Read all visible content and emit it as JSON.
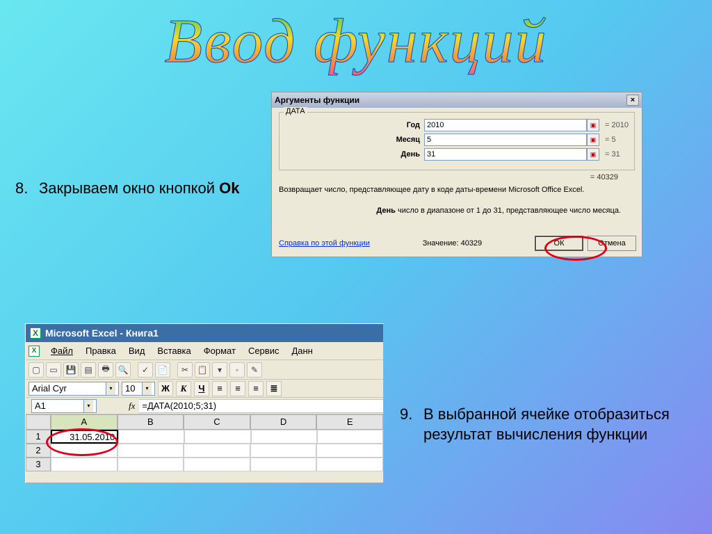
{
  "title": "Ввод функций",
  "bullets": {
    "b8_num": "8.",
    "b8_text_a": "Закрываем окно кнопкой ",
    "b8_text_b": "Ok",
    "b9_num": "9.",
    "b9_text": "В выбранной ячейке отобразиться результат вычисления функции"
  },
  "dialog": {
    "title": "Аргументы функции",
    "close": "×",
    "legend": "ДАТА",
    "args": {
      "year_label": "Год",
      "year_value": "2010",
      "year_eq": "= 2010",
      "month_label": "Месяц",
      "month_value": "5",
      "month_eq": "= 5",
      "day_label": "День",
      "day_value": "31",
      "day_eq": "= 31"
    },
    "result_eq": "= 40329",
    "desc1": "Возвращает число, представляющее дату в коде даты-времени Microsoft Office Excel.",
    "desc2_b": "День",
    "desc2": "  число в диапазоне от 1 до 31, представляющее число месяца.",
    "value_label": "Значение: 40329",
    "help": "Справка по этой функции",
    "ok": "ОК",
    "cancel": "Отмена",
    "pick_icon": "▣"
  },
  "excel": {
    "title": "Microsoft Excel - Книга1",
    "xicon": "X",
    "menu": [
      "Файл",
      "Правка",
      "Вид",
      "Вставка",
      "Формат",
      "Сервис",
      "Данн"
    ],
    "menu_underline_index": [
      0,
      0,
      0,
      3,
      4,
      1,
      0
    ],
    "toolbar_icons": [
      "▢",
      "▭",
      "💾",
      "▤",
      "🖶",
      "🔍",
      "✓",
      "📄",
      "✂",
      "📋",
      "▾",
      "◦",
      "✎",
      "▾"
    ],
    "font_name": "Arial Cyr",
    "font_size": "10",
    "bold": "Ж",
    "italic": "К",
    "underline": "Ч",
    "align_icons": [
      "≡",
      "≡",
      "≡",
      "≣"
    ],
    "name_box": "A1",
    "fx": "fx",
    "formula": "=ДАТА(2010;5;31)",
    "columns": [
      "A",
      "B",
      "C",
      "D",
      "E"
    ],
    "rows": [
      "1",
      "2",
      "3"
    ],
    "a1": "31.05.2010",
    "dropdown": "▾"
  }
}
